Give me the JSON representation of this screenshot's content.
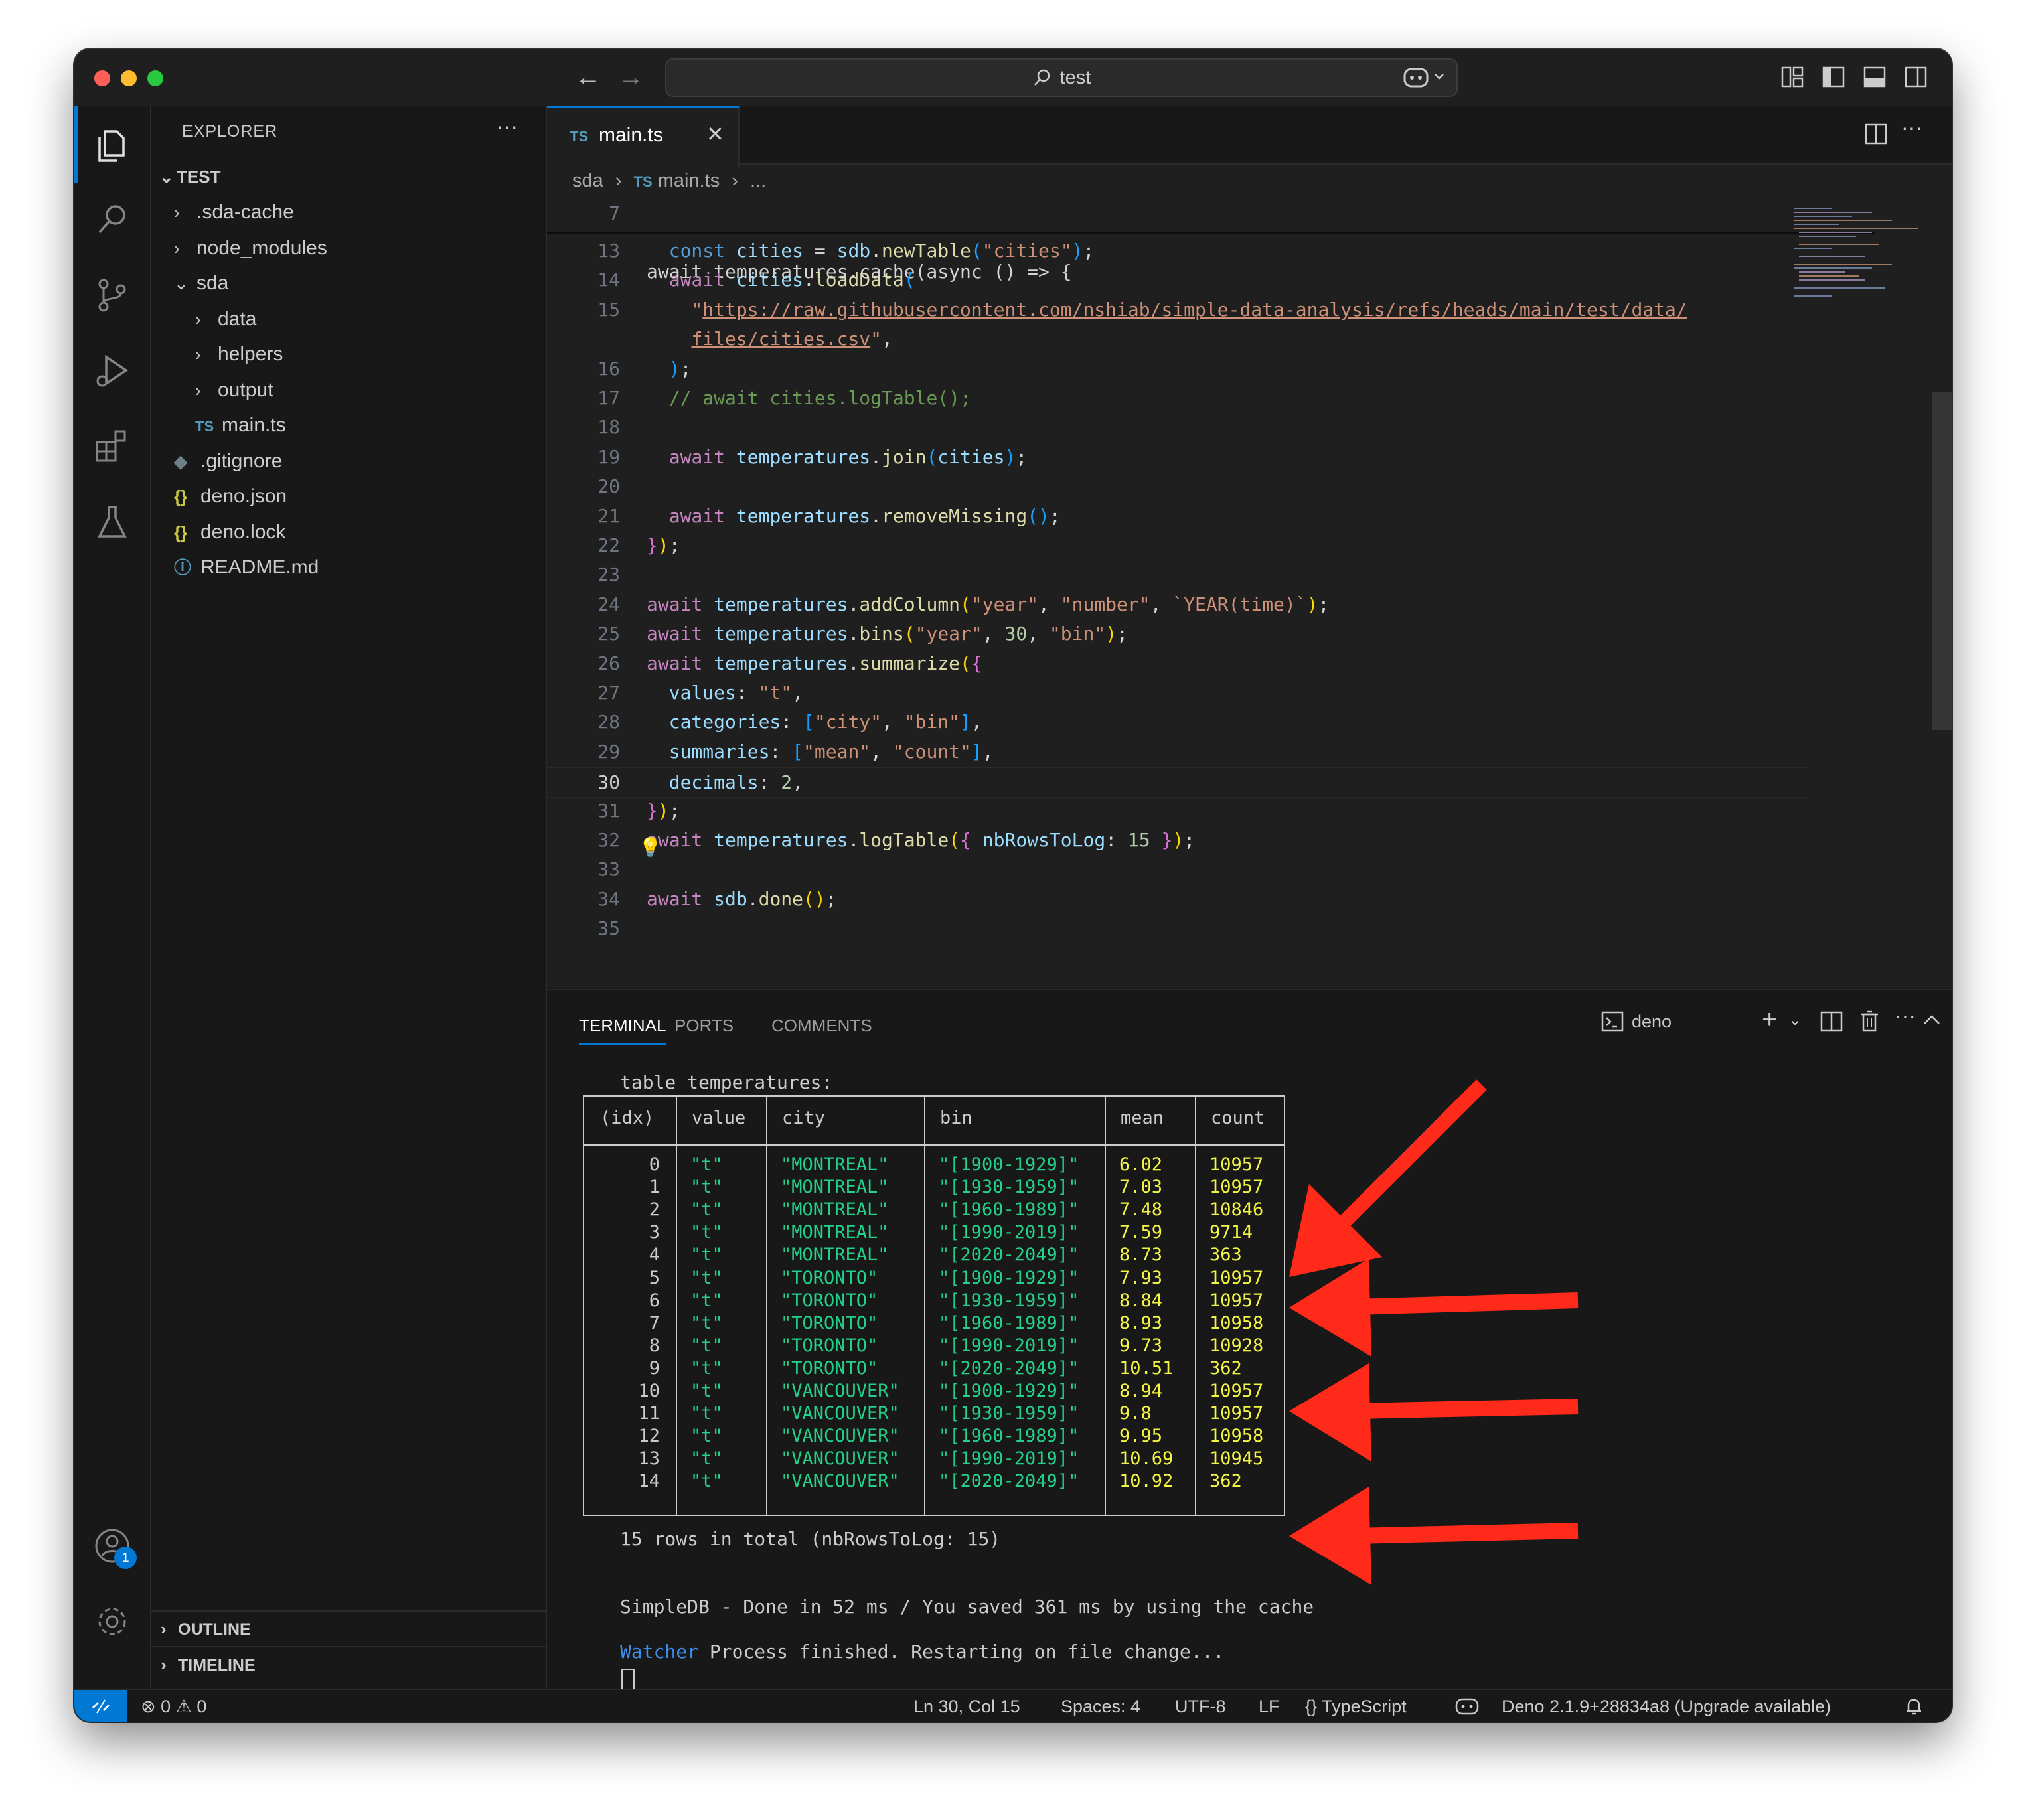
{
  "titlebar": {
    "search_text": "test"
  },
  "sidebar": {
    "title": "EXPLORER",
    "root": "TEST",
    "items": [
      {
        "label": ".sda-cache",
        "kind": "folder",
        "depth": 1,
        "expanded": false
      },
      {
        "label": "node_modules",
        "kind": "folder",
        "depth": 1,
        "expanded": false
      },
      {
        "label": "sda",
        "kind": "folder",
        "depth": 1,
        "expanded": true
      },
      {
        "label": "data",
        "kind": "folder",
        "depth": 2,
        "expanded": false
      },
      {
        "label": "helpers",
        "kind": "folder",
        "depth": 2,
        "expanded": false
      },
      {
        "label": "output",
        "kind": "folder",
        "depth": 2,
        "expanded": false
      },
      {
        "label": "main.ts",
        "kind": "ts",
        "depth": 2,
        "icon_text": "TS"
      },
      {
        "label": ".gitignore",
        "kind": "git",
        "depth": 1
      },
      {
        "label": "deno.json",
        "kind": "json",
        "depth": 1,
        "icon_text": "{}"
      },
      {
        "label": "deno.lock",
        "kind": "json",
        "depth": 1,
        "icon_text": "{}"
      },
      {
        "label": "README.md",
        "kind": "info",
        "depth": 1,
        "icon_text": "ⓘ"
      }
    ],
    "outline": "OUTLINE",
    "timeline": "TIMELINE"
  },
  "accounts_badge": "1",
  "editor": {
    "tab": {
      "icon_text": "TS",
      "label": "main.ts"
    },
    "breadcrumb": {
      "folder": "sda",
      "file_icon": "TS",
      "file": "main.ts",
      "more": "..."
    },
    "sticky": {
      "number": "7",
      "text": "await temperatures.cache(async () => {"
    },
    "lines": [
      {
        "n": "13",
        "tokens": [
          [
            "p",
            "  "
          ],
          [
            "kw",
            "const "
          ],
          [
            "v",
            "cities"
          ],
          [
            "p",
            " = "
          ],
          [
            "v",
            "sdb"
          ],
          [
            "p",
            "."
          ],
          [
            "f",
            "newTable"
          ],
          [
            "b3",
            "("
          ],
          [
            "s",
            "\"cities\""
          ],
          [
            "b3",
            ")"
          ],
          [
            "p",
            ";"
          ]
        ]
      },
      {
        "n": "14",
        "tokens": [
          [
            "p",
            "  "
          ],
          [
            "k",
            "await "
          ],
          [
            "v",
            "cities"
          ],
          [
            "p",
            "."
          ],
          [
            "f",
            "loadData"
          ],
          [
            "b3",
            "("
          ]
        ]
      },
      {
        "n": "15",
        "tokens": [
          [
            "p",
            "    "
          ],
          [
            "s",
            "\""
          ],
          [
            "su",
            "https://raw.githubusercontent.com/nshiab/simple-data-analysis/refs/heads/main/test/data/"
          ]
        ]
      },
      {
        "n": "",
        "tokens": [
          [
            "p",
            "    "
          ],
          [
            "su",
            "files/cities.csv"
          ],
          [
            "s",
            "\""
          ],
          [
            "p",
            ","
          ]
        ]
      },
      {
        "n": "16",
        "tokens": [
          [
            "p",
            "  "
          ],
          [
            "b3",
            ")"
          ],
          [
            "p",
            ";"
          ]
        ]
      },
      {
        "n": "17",
        "tokens": [
          [
            "p",
            "  "
          ],
          [
            "c",
            "// await cities.logTable();"
          ]
        ]
      },
      {
        "n": "18",
        "tokens": []
      },
      {
        "n": "19",
        "tokens": [
          [
            "p",
            "  "
          ],
          [
            "k",
            "await "
          ],
          [
            "v",
            "temperatures"
          ],
          [
            "p",
            "."
          ],
          [
            "f",
            "join"
          ],
          [
            "b3",
            "("
          ],
          [
            "v",
            "cities"
          ],
          [
            "b3",
            ")"
          ],
          [
            "p",
            ";"
          ]
        ]
      },
      {
        "n": "20",
        "tokens": []
      },
      {
        "n": "21",
        "tokens": [
          [
            "p",
            "  "
          ],
          [
            "k",
            "await "
          ],
          [
            "v",
            "temperatures"
          ],
          [
            "p",
            "."
          ],
          [
            "f",
            "removeMissing"
          ],
          [
            "b3",
            "()"
          ],
          [
            "p",
            ";"
          ]
        ]
      },
      {
        "n": "22",
        "tokens": [
          [
            "b2",
            "}"
          ],
          [
            "b1",
            ")"
          ],
          [
            "p",
            ";"
          ]
        ]
      },
      {
        "n": "23",
        "tokens": []
      },
      {
        "n": "24",
        "tokens": [
          [
            "k",
            "await "
          ],
          [
            "v",
            "temperatures"
          ],
          [
            "p",
            "."
          ],
          [
            "f",
            "addColumn"
          ],
          [
            "b1",
            "("
          ],
          [
            "s",
            "\"year\""
          ],
          [
            "p",
            ", "
          ],
          [
            "s",
            "\"number\""
          ],
          [
            "p",
            ", "
          ],
          [
            "s",
            "`YEAR(time)`"
          ],
          [
            "b1",
            ")"
          ],
          [
            "p",
            ";"
          ]
        ]
      },
      {
        "n": "25",
        "tokens": [
          [
            "k",
            "await "
          ],
          [
            "v",
            "temperatures"
          ],
          [
            "p",
            "."
          ],
          [
            "f",
            "bins"
          ],
          [
            "b1",
            "("
          ],
          [
            "s",
            "\"year\""
          ],
          [
            "p",
            ", "
          ],
          [
            "n",
            "30"
          ],
          [
            "p",
            ", "
          ],
          [
            "s",
            "\"bin\""
          ],
          [
            "b1",
            ")"
          ],
          [
            "p",
            ";"
          ]
        ]
      },
      {
        "n": "26",
        "tokens": [
          [
            "k",
            "await "
          ],
          [
            "v",
            "temperatures"
          ],
          [
            "p",
            "."
          ],
          [
            "f",
            "summarize"
          ],
          [
            "b1",
            "("
          ],
          [
            "b2",
            "{"
          ]
        ]
      },
      {
        "n": "27",
        "tokens": [
          [
            "p",
            "  "
          ],
          [
            "v",
            "values"
          ],
          [
            "p",
            ": "
          ],
          [
            "s",
            "\"t\""
          ],
          [
            "p",
            ","
          ]
        ]
      },
      {
        "n": "28",
        "tokens": [
          [
            "p",
            "  "
          ],
          [
            "v",
            "categories"
          ],
          [
            "p",
            ": "
          ],
          [
            "b3",
            "["
          ],
          [
            "s",
            "\"city\""
          ],
          [
            "p",
            ", "
          ],
          [
            "s",
            "\"bin\""
          ],
          [
            "b3",
            "]"
          ],
          [
            "p",
            ","
          ]
        ]
      },
      {
        "n": "29",
        "tokens": [
          [
            "p",
            "  "
          ],
          [
            "v",
            "summaries"
          ],
          [
            "p",
            ": "
          ],
          [
            "b3",
            "["
          ],
          [
            "s",
            "\"mean\""
          ],
          [
            "p",
            ", "
          ],
          [
            "s",
            "\"count\""
          ],
          [
            "b3",
            "]"
          ],
          [
            "p",
            ","
          ]
        ]
      },
      {
        "n": "30",
        "tokens": [
          [
            "p",
            "  "
          ],
          [
            "v",
            "decimals"
          ],
          [
            "p",
            ": "
          ],
          [
            "n",
            "2"
          ],
          [
            "p",
            ","
          ]
        ]
      },
      {
        "n": "31",
        "tokens": [
          [
            "b2",
            "}"
          ],
          [
            "b1",
            ")"
          ],
          [
            "p",
            ";"
          ]
        ]
      },
      {
        "n": "32",
        "tokens": [
          [
            "k",
            "await "
          ],
          [
            "v",
            "temperatures"
          ],
          [
            "p",
            "."
          ],
          [
            "f",
            "logTable"
          ],
          [
            "b1",
            "("
          ],
          [
            "b2",
            "{ "
          ],
          [
            "v",
            "nbRowsToLog"
          ],
          [
            "p",
            ": "
          ],
          [
            "n",
            "15"
          ],
          [
            "b2",
            " }"
          ],
          [
            "b1",
            ")"
          ],
          [
            "p",
            ";"
          ]
        ]
      },
      {
        "n": "33",
        "tokens": []
      },
      {
        "n": "34",
        "tokens": [
          [
            "k",
            "await "
          ],
          [
            "v",
            "sdb"
          ],
          [
            "p",
            "."
          ],
          [
            "f",
            "done"
          ],
          [
            "b1",
            "()"
          ],
          [
            "p",
            ";"
          ]
        ]
      },
      {
        "n": "35",
        "tokens": []
      }
    ]
  },
  "panel": {
    "tabs": [
      "TERMINAL",
      "PORTS",
      "COMMENTS"
    ],
    "terminal_name": "deno",
    "table_title": "table temperatures:",
    "columns": [
      "(idx)",
      "value",
      "city",
      "bin",
      "mean",
      "count"
    ],
    "rows": [
      [
        "0",
        "\"t\"",
        "\"MONTREAL\"",
        "\"[1900-1929]\"",
        "6.02",
        "10957"
      ],
      [
        "1",
        "\"t\"",
        "\"MONTREAL\"",
        "\"[1930-1959]\"",
        "7.03",
        "10957"
      ],
      [
        "2",
        "\"t\"",
        "\"MONTREAL\"",
        "\"[1960-1989]\"",
        "7.48",
        "10846"
      ],
      [
        "3",
        "\"t\"",
        "\"MONTREAL\"",
        "\"[1990-2019]\"",
        "7.59",
        "9714"
      ],
      [
        "4",
        "\"t\"",
        "\"MONTREAL\"",
        "\"[2020-2049]\"",
        "8.73",
        "363"
      ],
      [
        "5",
        "\"t\"",
        "\"TORONTO\"",
        "\"[1900-1929]\"",
        "7.93",
        "10957"
      ],
      [
        "6",
        "\"t\"",
        "\"TORONTO\"",
        "\"[1930-1959]\"",
        "8.84",
        "10957"
      ],
      [
        "7",
        "\"t\"",
        "\"TORONTO\"",
        "\"[1960-1989]\"",
        "8.93",
        "10958"
      ],
      [
        "8",
        "\"t\"",
        "\"TORONTO\"",
        "\"[1990-2019]\"",
        "9.73",
        "10928"
      ],
      [
        "9",
        "\"t\"",
        "\"TORONTO\"",
        "\"[2020-2049]\"",
        "10.51",
        "362"
      ],
      [
        "10",
        "\"t\"",
        "\"VANCOUVER\"",
        "\"[1900-1929]\"",
        "8.94",
        "10957"
      ],
      [
        "11",
        "\"t\"",
        "\"VANCOUVER\"",
        "\"[1930-1959]\"",
        "9.8",
        "10957"
      ],
      [
        "12",
        "\"t\"",
        "\"VANCOUVER\"",
        "\"[1960-1989]\"",
        "9.95",
        "10958"
      ],
      [
        "13",
        "\"t\"",
        "\"VANCOUVER\"",
        "\"[1990-2019]\"",
        "10.69",
        "10945"
      ],
      [
        "14",
        "\"t\"",
        "\"VANCOUVER\"",
        "\"[2020-2049]\"",
        "10.92",
        "362"
      ]
    ],
    "rows_total": "15 rows in total (nbRowsToLog: 15)",
    "done_msg": "SimpleDB - Done in 52 ms / You saved 361 ms by using the cache",
    "watcher_label": "Watcher",
    "watcher_msg": " Process finished. Restarting on file change..."
  },
  "statusbar": {
    "errors": "0",
    "warnings": "0",
    "position": "Ln 30, Col 15",
    "spaces": "Spaces: 4",
    "encoding": "UTF-8",
    "eol": "LF",
    "language": "TypeScript",
    "runtime": "Deno 2.1.9+28834a8 (Upgrade available)"
  },
  "colors": {
    "accent": "#0078d4",
    "arrow": "#ff2a1a",
    "term_green": "#23d18b",
    "term_yellow": "#f5f543",
    "watcher_blue": "#3b8eea"
  }
}
